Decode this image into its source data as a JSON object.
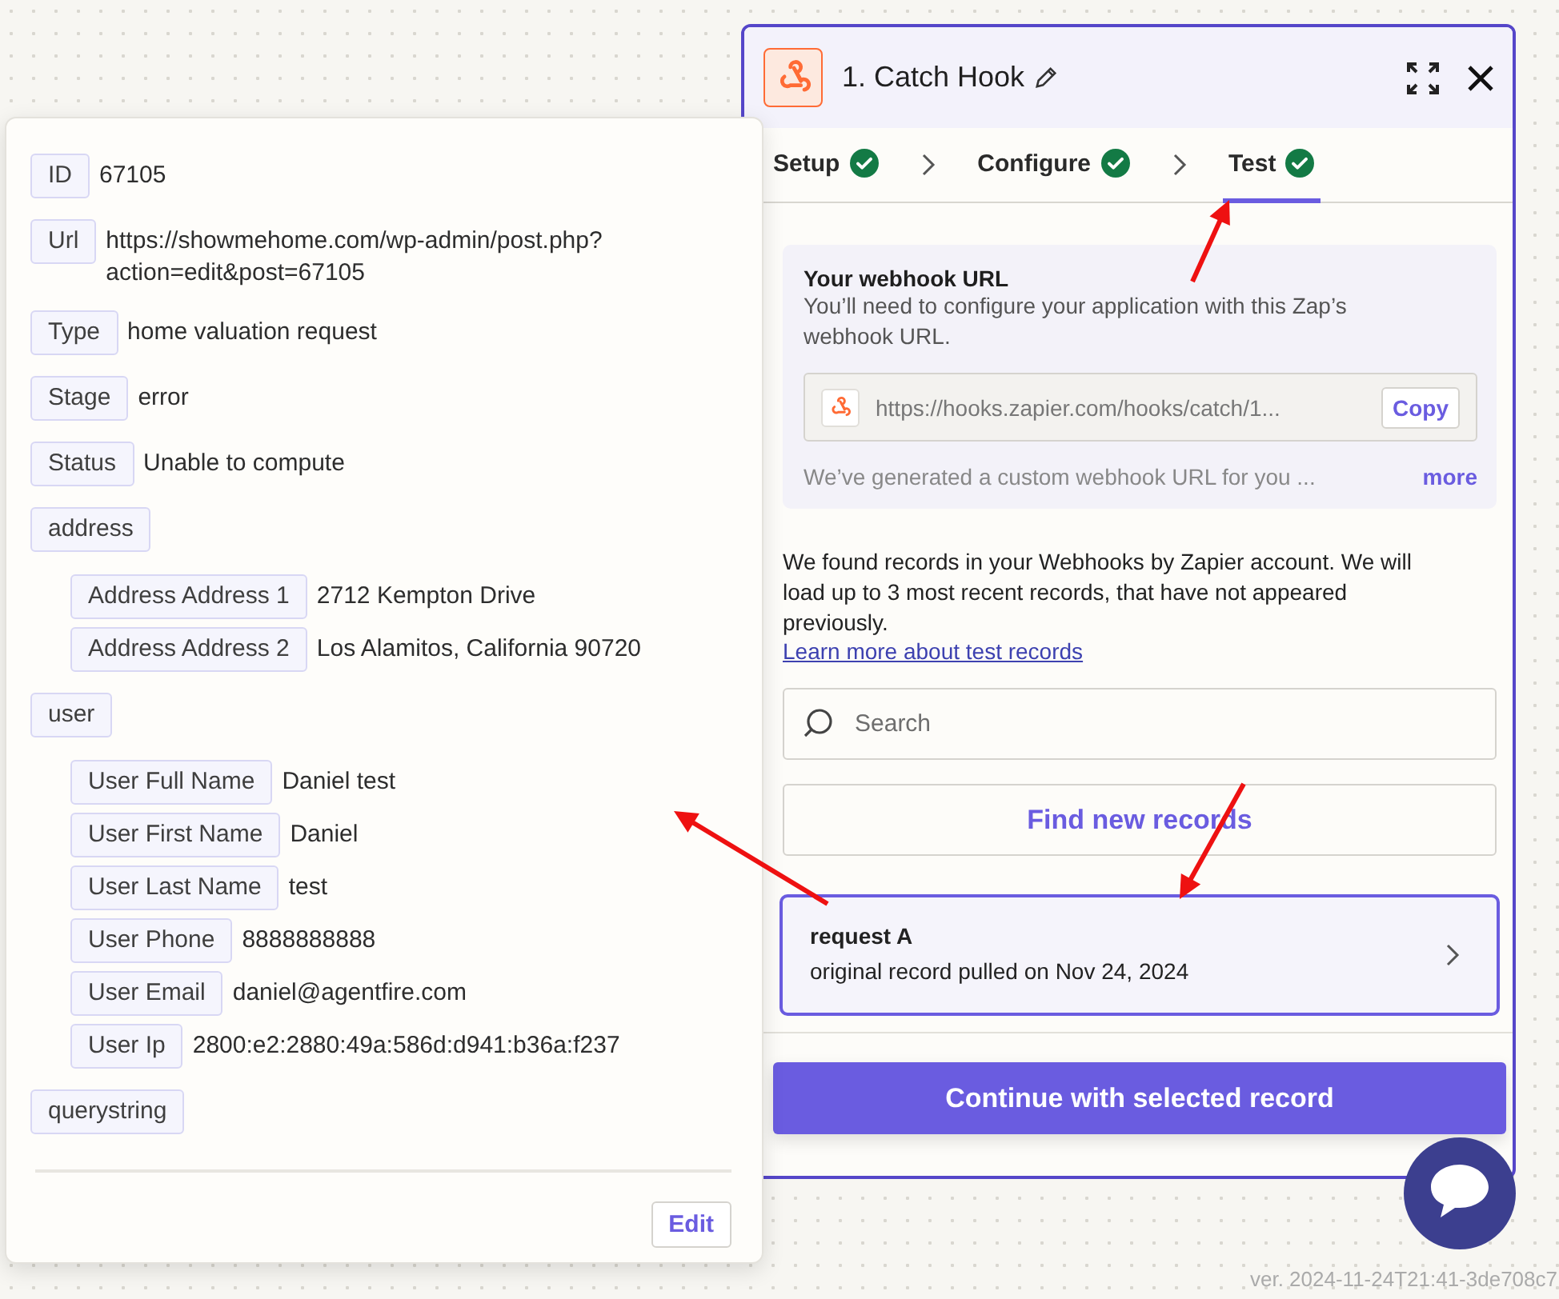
{
  "popover": {
    "fields": [
      {
        "label": "ID",
        "value": "67105"
      },
      {
        "label": "Url",
        "value": "https://showmehome.com/wp-admin/post.php?action=edit&post=67105"
      },
      {
        "label": "Type",
        "value": "home valuation request"
      },
      {
        "label": "Stage",
        "value": "error"
      },
      {
        "label": "Status",
        "value": "Unable to compute"
      },
      {
        "label": "address",
        "children": [
          {
            "label": "Address Address 1",
            "value": "2712 Kempton Drive"
          },
          {
            "label": "Address Address 2",
            "value": "Los Alamitos, California 90720"
          }
        ]
      },
      {
        "label": "user",
        "children": [
          {
            "label": "User Full Name",
            "value": "Daniel test"
          },
          {
            "label": "User First Name",
            "value": "Daniel"
          },
          {
            "label": "User Last Name",
            "value": "test"
          },
          {
            "label": "User Phone",
            "value": "8888888888"
          },
          {
            "label": "User Email",
            "value": "daniel@agentfire.com"
          },
          {
            "label": "User Ip",
            "value": "2800:e2:2880:49a:586d:d941:b36a:f237"
          }
        ]
      },
      {
        "label": "querystring"
      }
    ],
    "edit_button": "Edit"
  },
  "panel": {
    "title": "1. Catch Hook",
    "tabs": [
      {
        "label": "Setup",
        "selected": false,
        "completed": true
      },
      {
        "label": "Configure",
        "selected": false,
        "completed": true
      },
      {
        "label": "Test",
        "selected": true,
        "completed": true
      }
    ],
    "webhook": {
      "title": "Your webhook URL",
      "description": "You’ll need to configure your application with this Zap’s webhook URL.",
      "url": "https://hooks.zapier.com/hooks/catch/1...",
      "copy_button": "Copy",
      "note": "We’ve generated a custom webhook URL for you ...",
      "more_link": "more"
    },
    "intro": "We found records in your Webhooks by Zapier account. We will load up to 3 most recent records, that have not appeared previously.",
    "learn_link": "Learn more about test records",
    "search": {
      "placeholder": "Search"
    },
    "find_button": "Find new records",
    "records": [
      {
        "title": "request A",
        "subtitle": "original record pulled on Nov 24, 2024",
        "selected": true
      }
    ],
    "continue_button": "Continue with selected record"
  },
  "version": "ver. 2024-11-24T21:41-3de708c7"
}
